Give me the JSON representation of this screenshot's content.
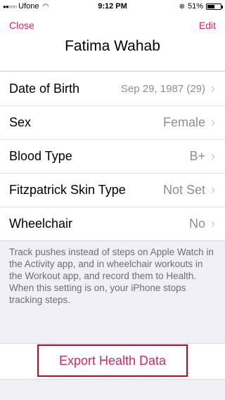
{
  "status_bar": {
    "carrier": "Ufone",
    "time": "9:12 PM",
    "battery_percent": "51%"
  },
  "header": {
    "close_label": "Close",
    "edit_label": "Edit",
    "title": "Fatima Wahab"
  },
  "rows": [
    {
      "label": "Date of Birth",
      "value": "Sep 29, 1987 (29)"
    },
    {
      "label": "Sex",
      "value": "Female"
    },
    {
      "label": "Blood Type",
      "value": "B+"
    },
    {
      "label": "Fitzpatrick Skin Type",
      "value": "Not Set"
    },
    {
      "label": "Wheelchair",
      "value": "No"
    }
  ],
  "footer_text": "Track pushes instead of steps on Apple Watch in the Activity app, and in wheelchair workouts in the Workout app, and record them to Health. When this setting is on, your iPhone stops tracking steps.",
  "export_label": "Export Health Data",
  "colors": {
    "accent": "#e0245e",
    "highlight_border": "#d0021b",
    "secondary_text": "#8e8e93",
    "background": "#efeff4"
  },
  "icons": {
    "chevron": "chevron-right-icon",
    "wifi": "wifi-icon",
    "battery": "battery-icon"
  }
}
